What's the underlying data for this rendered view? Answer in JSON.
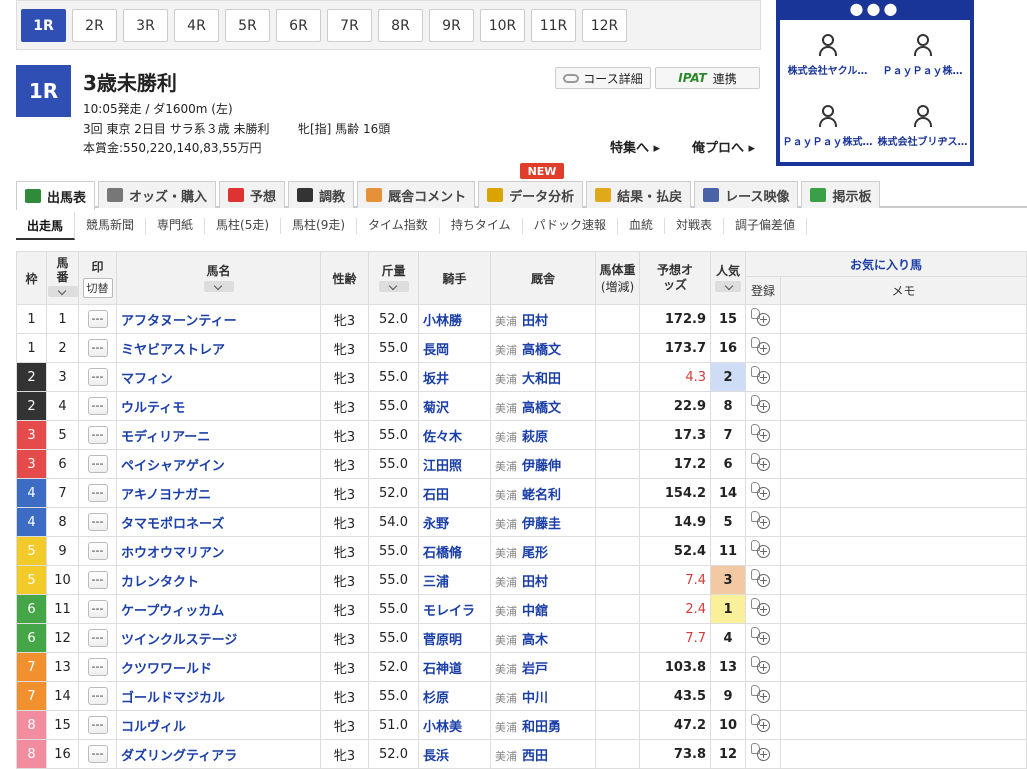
{
  "race_tabs": [
    {
      "label": "1R",
      "active": true
    },
    {
      "label": "2R"
    },
    {
      "label": "3R"
    },
    {
      "label": "4R"
    },
    {
      "label": "5R"
    },
    {
      "label": "6R"
    },
    {
      "label": "7R"
    },
    {
      "label": "8R"
    },
    {
      "label": "9R"
    },
    {
      "label": "10R"
    },
    {
      "label": "11R"
    },
    {
      "label": "12R"
    }
  ],
  "race": {
    "number": "1R",
    "name": "3歳未勝利",
    "line1": "10:05発走 / ダ1600m (左)",
    "line2a": "3回 東京 2日目 サラ系３歳 未勝利",
    "line2b": "牝[指] 馬齢 16頭",
    "line3": "本賞金:550,220,140,83,55万円"
  },
  "buttons": {
    "course": "コース詳細",
    "ipat_logo": "IPAT",
    "ipat_label": "連携",
    "feature": "特集へ ▸",
    "pro": "俺プロへ ▸"
  },
  "ad": {
    "dots": "●●●",
    "items": [
      {
        "label": "株式会社ヤクル…",
        "icon": "person-icon"
      },
      {
        "label": "ＰａｙＰａｙ株…",
        "icon": "building-icon"
      },
      {
        "label": "ＰａｙＰａｙ株式…",
        "icon": "building-icon"
      },
      {
        "label": "株式会社ブリヂス…",
        "icon": "building-icon"
      }
    ]
  },
  "main_tabs": [
    {
      "label": "出馬表",
      "icon_color": "#2f8a3a",
      "active": true
    },
    {
      "label": "オッズ・購入",
      "icon_color": "#777"
    },
    {
      "label": "予想",
      "icon_color": "#d33"
    },
    {
      "label": "調教",
      "icon_color": "#333"
    },
    {
      "label": "厩舎コメント",
      "icon_color": "#e5913a"
    },
    {
      "label": "データ分析",
      "icon_color": "#d9a300"
    },
    {
      "label": "結果・払戻",
      "icon_color": "#e0a91a"
    },
    {
      "label": "レース映像",
      "icon_color": "#4a62a8"
    },
    {
      "label": "掲示板",
      "icon_color": "#3aa046"
    }
  ],
  "new_badge": "NEW",
  "sub_tabs": [
    {
      "label": "出走馬",
      "active": true
    },
    {
      "label": "競馬新聞"
    },
    {
      "label": "専門紙"
    },
    {
      "label": "馬柱(5走)"
    },
    {
      "label": "馬柱(9走)"
    },
    {
      "label": "タイム指数"
    },
    {
      "label": "持ちタイム"
    },
    {
      "label": "パドック速報"
    },
    {
      "label": "血統"
    },
    {
      "label": "対戦表"
    },
    {
      "label": "調子偏差値"
    }
  ],
  "table": {
    "headers": {
      "waku": "枠",
      "umaban": "馬番",
      "mark": "印",
      "kiri": "切替",
      "name": "馬名",
      "sexage": "性齢",
      "weight": "斤量",
      "jockey": "騎手",
      "trainer": "厩舎",
      "body": "馬体重",
      "body_sub": "(増減)",
      "odds": "予想オッズ",
      "pop": "人気",
      "favorite": "お気に入り馬",
      "register": "登録",
      "memo": "メモ"
    },
    "mark_symbol": "---",
    "rows": [
      {
        "waku": "1",
        "umaban": "1",
        "name": "アフタヌーンティー",
        "sexage": "牝3",
        "weight": "52.0",
        "jockey": "小林勝",
        "region": "美浦",
        "trainer": "田村",
        "odds": "172.9",
        "pop": "15"
      },
      {
        "waku": "1",
        "umaban": "2",
        "name": "ミヤビアストレア",
        "sexage": "牝3",
        "weight": "55.0",
        "jockey": "長岡",
        "region": "美浦",
        "trainer": "高橋文",
        "odds": "173.7",
        "pop": "16"
      },
      {
        "waku": "2",
        "umaban": "3",
        "name": "マフィン",
        "sexage": "牝3",
        "weight": "55.0",
        "jockey": "坂井",
        "region": "美浦",
        "trainer": "大和田",
        "odds": "4.3",
        "pop": "2",
        "hot": true,
        "pop_bg": "#cfdcf5"
      },
      {
        "waku": "2",
        "umaban": "4",
        "name": "ウルティモ",
        "sexage": "牝3",
        "weight": "55.0",
        "jockey": "菊沢",
        "region": "美浦",
        "trainer": "高橋文",
        "odds": "22.9",
        "pop": "8"
      },
      {
        "waku": "3",
        "umaban": "5",
        "name": "モディリアーニ",
        "sexage": "牝3",
        "weight": "55.0",
        "jockey": "佐々木",
        "region": "美浦",
        "trainer": "萩原",
        "odds": "17.3",
        "pop": "7"
      },
      {
        "waku": "3",
        "umaban": "6",
        "name": "ペイシャアゲイン",
        "sexage": "牝3",
        "weight": "55.0",
        "jockey": "江田照",
        "region": "美浦",
        "trainer": "伊藤伸",
        "odds": "17.2",
        "pop": "6"
      },
      {
        "waku": "4",
        "umaban": "7",
        "name": "アキノヨナガニ",
        "sexage": "牝3",
        "weight": "52.0",
        "jockey": "石田",
        "region": "美浦",
        "trainer": "蛯名利",
        "odds": "154.2",
        "pop": "14"
      },
      {
        "waku": "4",
        "umaban": "8",
        "name": "タマモポロネーズ",
        "sexage": "牝3",
        "weight": "54.0",
        "jockey": "永野",
        "region": "美浦",
        "trainer": "伊藤圭",
        "odds": "14.9",
        "pop": "5"
      },
      {
        "waku": "5",
        "umaban": "9",
        "name": "ホウオウマリアン",
        "sexage": "牝3",
        "weight": "55.0",
        "jockey": "石橋脩",
        "region": "美浦",
        "trainer": "尾形",
        "odds": "52.4",
        "pop": "11"
      },
      {
        "waku": "5",
        "umaban": "10",
        "name": "カレンタクト",
        "sexage": "牝3",
        "weight": "55.0",
        "jockey": "三浦",
        "region": "美浦",
        "trainer": "田村",
        "odds": "7.4",
        "pop": "3",
        "hot": true,
        "pop_bg": "#f3c9a3"
      },
      {
        "waku": "6",
        "umaban": "11",
        "name": "ケープウィッカム",
        "sexage": "牝3",
        "weight": "55.0",
        "jockey": "モレイラ",
        "region": "美浦",
        "trainer": "中舘",
        "odds": "2.4",
        "pop": "1",
        "hot": true,
        "pop_bg": "#fbf09a"
      },
      {
        "waku": "6",
        "umaban": "12",
        "name": "ツインクルステージ",
        "sexage": "牝3",
        "weight": "55.0",
        "jockey": "菅原明",
        "region": "美浦",
        "trainer": "高木",
        "odds": "7.7",
        "pop": "4",
        "hot": true
      },
      {
        "waku": "7",
        "umaban": "13",
        "name": "クツワワールド",
        "sexage": "牝3",
        "weight": "52.0",
        "jockey": "石神道",
        "region": "美浦",
        "trainer": "岩戸",
        "odds": "103.8",
        "pop": "13"
      },
      {
        "waku": "7",
        "umaban": "14",
        "name": "ゴールドマジカル",
        "sexage": "牝3",
        "weight": "55.0",
        "jockey": "杉原",
        "region": "美浦",
        "trainer": "中川",
        "odds": "43.5",
        "pop": "9"
      },
      {
        "waku": "8",
        "umaban": "15",
        "name": "コルヴィル",
        "sexage": "牝3",
        "weight": "51.0",
        "jockey": "小林美",
        "region": "美浦",
        "trainer": "和田勇",
        "odds": "47.2",
        "pop": "10"
      },
      {
        "waku": "8",
        "umaban": "16",
        "name": "ダズリングティアラ",
        "sexage": "牝3",
        "weight": "52.0",
        "jockey": "長浜",
        "region": "美浦",
        "trainer": "西田",
        "odds": "73.8",
        "pop": "12"
      }
    ]
  },
  "waku_colors": {
    "1": {
      "bg": "#ffffff",
      "fg": "#222222"
    },
    "2": {
      "bg": "#333333",
      "fg": "#ffffff"
    },
    "3": {
      "bg": "#e54b4b",
      "fg": "#ffffff"
    },
    "4": {
      "bg": "#3d6cc4",
      "fg": "#ffffff"
    },
    "5": {
      "bg": "#f2cb2a",
      "fg": "#ffffff"
    },
    "6": {
      "bg": "#45a648",
      "fg": "#ffffff"
    },
    "7": {
      "bg": "#f0902e",
      "fg": "#ffffff"
    },
    "8": {
      "bg": "#f28da0",
      "fg": "#ffffff"
    }
  }
}
